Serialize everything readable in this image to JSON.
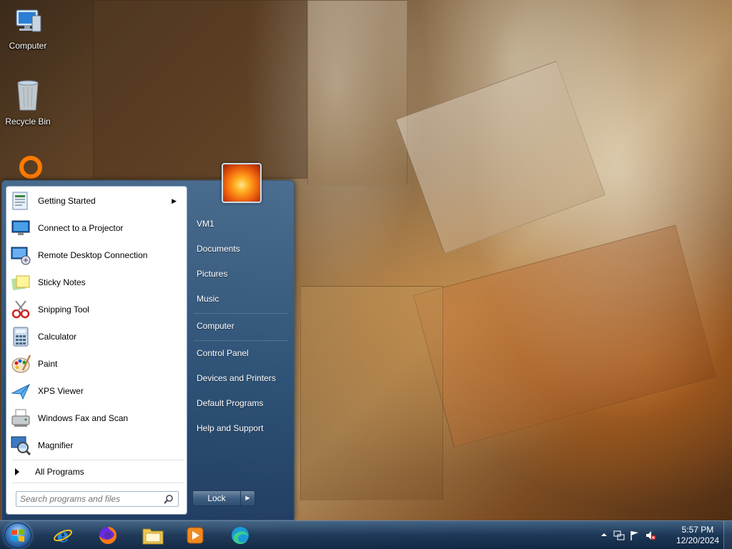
{
  "desktop": {
    "icons": [
      {
        "label": "Computer",
        "icon": "computer-icon"
      },
      {
        "label": "Recycle Bin",
        "icon": "recycle-bin-icon"
      },
      {
        "label": "",
        "icon": "ring-app-icon"
      }
    ]
  },
  "start_menu": {
    "programs": [
      {
        "label": "Getting Started",
        "icon": "getting-started-icon",
        "has_submenu": true
      },
      {
        "label": "Connect to a Projector",
        "icon": "projector-icon"
      },
      {
        "label": "Remote Desktop Connection",
        "icon": "remote-desktop-icon"
      },
      {
        "label": "Sticky Notes",
        "icon": "sticky-notes-icon"
      },
      {
        "label": "Snipping Tool",
        "icon": "snipping-tool-icon"
      },
      {
        "label": "Calculator",
        "icon": "calculator-icon"
      },
      {
        "label": "Paint",
        "icon": "paint-icon"
      },
      {
        "label": "XPS Viewer",
        "icon": "xps-viewer-icon"
      },
      {
        "label": "Windows Fax and Scan",
        "icon": "fax-scan-icon"
      },
      {
        "label": "Magnifier",
        "icon": "magnifier-icon"
      }
    ],
    "all_programs_label": "All Programs",
    "search_placeholder": "Search programs and files",
    "right_items": [
      {
        "label": "VM1"
      },
      {
        "label": "Documents"
      },
      {
        "label": "Pictures"
      },
      {
        "label": "Music"
      },
      {
        "label": "Computer"
      },
      {
        "label": "Control Panel"
      },
      {
        "label": "Devices and Printers"
      },
      {
        "label": "Default Programs"
      },
      {
        "label": "Help and Support"
      }
    ],
    "lock_label": "Lock"
  },
  "taskbar": {
    "apps": [
      {
        "icon": "internet-explorer-icon"
      },
      {
        "icon": "firefox-icon"
      },
      {
        "icon": "file-explorer-icon"
      },
      {
        "icon": "media-player-icon"
      },
      {
        "icon": "edge-icon"
      }
    ],
    "clock_time": "5:57 PM",
    "clock_date": "12/20/2024"
  },
  "colors": {
    "menu_blue": "#2f5a86",
    "taskbar": "#1a3a60"
  }
}
